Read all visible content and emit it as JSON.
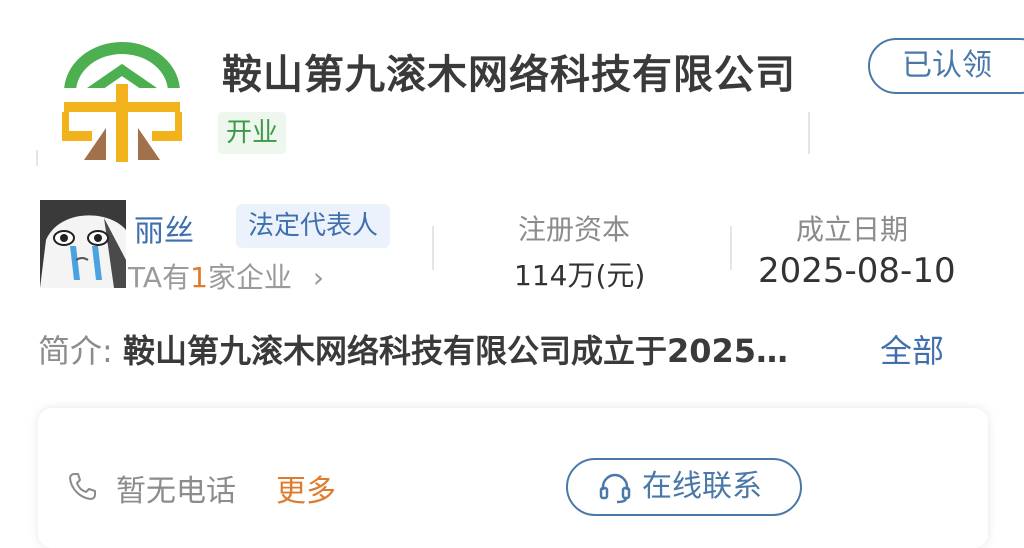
{
  "company": {
    "name": "鞍山第九滚木网络科技有限公司",
    "status": "开业",
    "claimed_label": "已认领",
    "logo_icon": "company-logo-icon"
  },
  "representative": {
    "name": "丽丝",
    "role": "法定代表人",
    "companies_prefix": "TA有",
    "companies_count": "1",
    "companies_suffix": "家企业",
    "chevron": "›"
  },
  "registered_capital": {
    "label": "注册资本",
    "value": "114万(元)"
  },
  "established": {
    "label": "成立日期",
    "value": "2025-08-10"
  },
  "intro": {
    "label": "简介:",
    "text": "鞍山第九滚木网络科技有限公司成立于2025…",
    "all_link": "全部"
  },
  "contact": {
    "phone_text": "暂无电话",
    "more_link": "更多",
    "online_button": "在线联系"
  },
  "colors": {
    "brand_blue": "#4a78a8",
    "status_green": "#3c9a46",
    "accent_orange": "#e07b2b",
    "logo_green": "#4caf50",
    "logo_gold": "#f2b21b"
  }
}
